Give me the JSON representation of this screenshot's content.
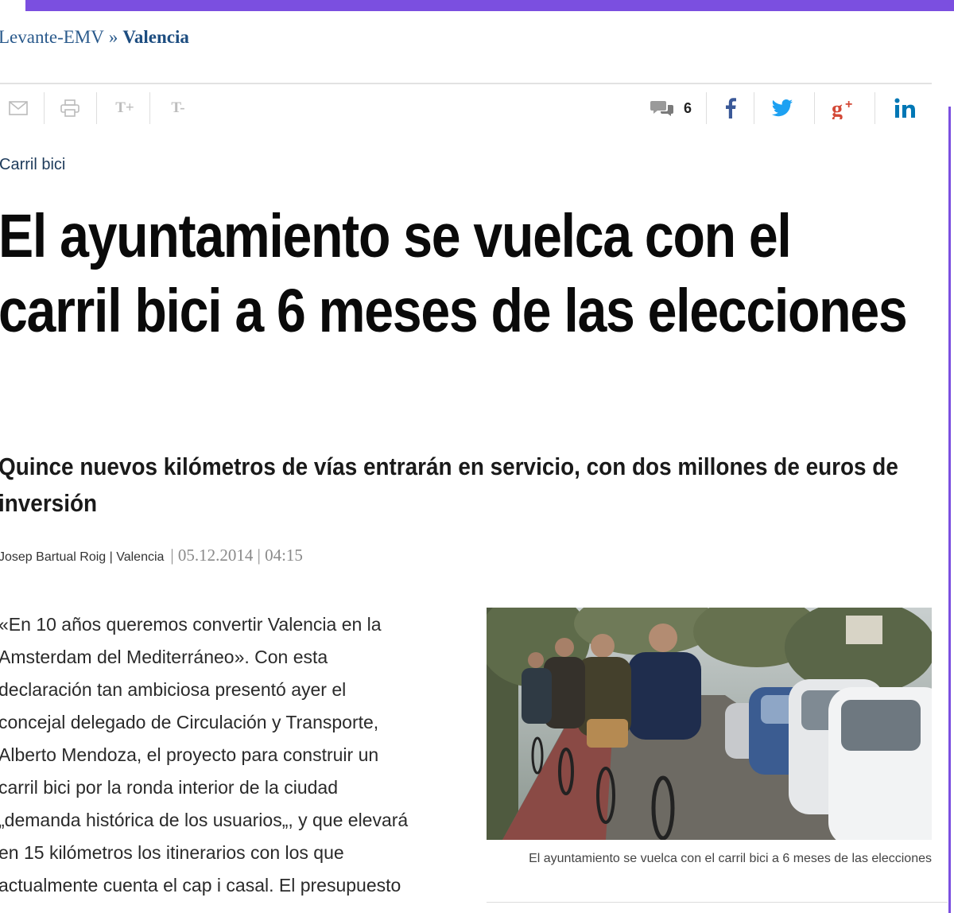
{
  "breadcrumb": {
    "site": "Levante-EMV",
    "separator": "»",
    "section": "Valencia"
  },
  "toolbar": {
    "items": [
      "email-icon",
      "print-icon",
      "text-increase",
      "text-decrease"
    ],
    "text_increase_label": "T+",
    "text_decrease_label": "T-",
    "comment_count": "6",
    "share": [
      "facebook-icon",
      "twitter-icon",
      "google-plus-icon",
      "linkedin-icon"
    ],
    "brand_colors": {
      "facebook": "#3b5998",
      "twitter": "#1da1f2",
      "google_plus": "#d34836",
      "linkedin": "#0077b5"
    }
  },
  "article": {
    "kicker": "Carril bici",
    "headline": "El ayuntamiento se vuelca con el carril bici a 6 meses de las elecciones",
    "subheadline": "Quince nuevos kilómetros de vías entrarán en servicio, con dos millones de euros de inversión",
    "byline": "Josep Bartual Roig | Valencia",
    "date": "| 05.12.2014 | 04:15",
    "body_lines": [
      "«En 10 años queremos convertir Valencia en la",
      "Amsterdam del Mediterráneo». Con esta",
      "declaración tan ambiciosa presentó ayer el",
      "concejal delegado de Circulación y Transporte,",
      "Alberto Mendoza, el proyecto para construir un",
      "carril bici por la ronda interior de la ciudad",
      "„demanda histórica de los usuarios„, y que elevará",
      "en 15 kilómetros los itinerarios con los que",
      "actualmente cuenta el cap i casal. El presupuesto"
    ],
    "photo_caption": "El ayuntamiento se vuelca con el carril bici a 6 meses de las elecciones"
  },
  "colors": {
    "accent": "#7b4fe0",
    "link": "#2a5a8c"
  }
}
